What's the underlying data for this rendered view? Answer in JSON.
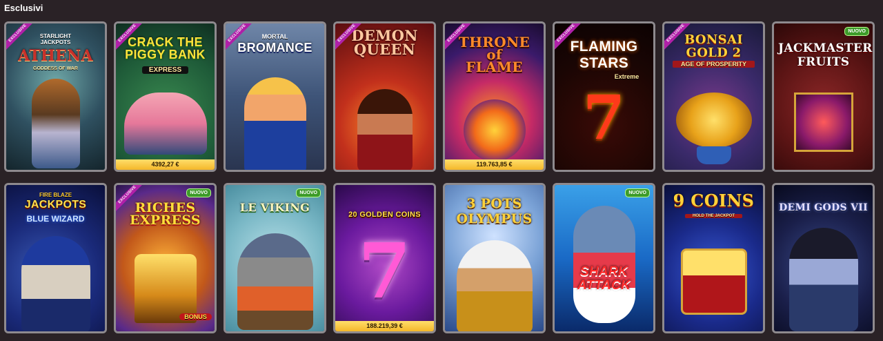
{
  "section": {
    "title": "Esclusivi"
  },
  "badges": {
    "exclusive": "EXCLUSIVE",
    "new": "NUOVO"
  },
  "games": [
    {
      "title": "ATHENA",
      "subtitle": "STARLIGHT\nJACKPOTS",
      "tagline": "GODDESS OF WAR",
      "jackpot": null
    },
    {
      "title": "CRACK THE\nPIGGY BANK",
      "subtitle": "EXPRESS",
      "jackpot": "4392,27 €"
    },
    {
      "title": "BROMANCE",
      "subtitle": "MORTAL",
      "jackpot": null
    },
    {
      "title": "DEMON\nQUEEN",
      "jackpot": null
    },
    {
      "title": "THRONE\nof\nFLAME",
      "jackpot": "119.763,85 €"
    },
    {
      "title": "FLAMING\nSTARS",
      "subtitle": "Extreme",
      "jackpot": null
    },
    {
      "title": "BONSAI\nGOLD 2",
      "subtitle": "AGE OF PROSPERITY",
      "jackpot": null
    },
    {
      "title": "JACKMASTER\nFRUITS",
      "jackpot": null
    },
    {
      "title": "JACKPOTS",
      "subtitle": "FIRE BLAZE",
      "tagline": "BLUE WIZARD",
      "jackpot": null
    },
    {
      "title": "RICHES\nEXPRESS",
      "tagline": "BONUS",
      "jackpot": null
    },
    {
      "title": "LE VIKING",
      "jackpot": null
    },
    {
      "title": "20 GOLDEN COINS",
      "jackpot": "188.219,39 €"
    },
    {
      "title": "3 POTS\nOLYMPUS",
      "jackpot": null
    },
    {
      "title": "SHARK\nATTACK",
      "jackpot": null
    },
    {
      "title": "9 COINS",
      "subtitle": "HOLD THE JACKPOT",
      "jackpot": null
    },
    {
      "title": "DEMI GODS VII",
      "jackpot": null
    }
  ]
}
